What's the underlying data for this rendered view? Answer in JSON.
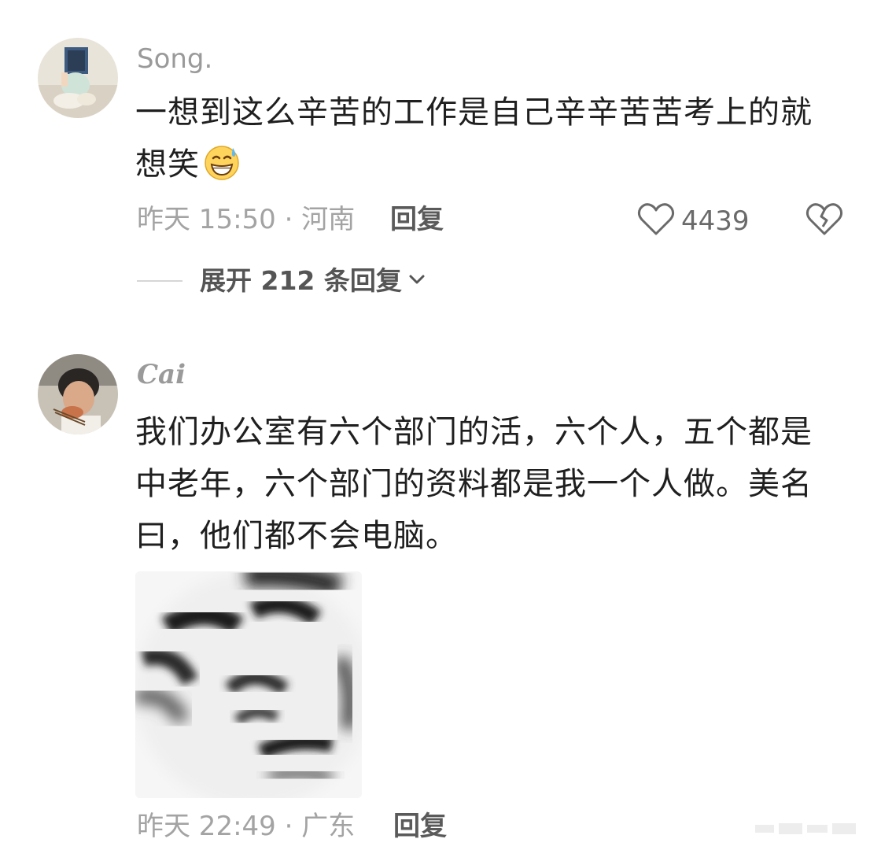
{
  "comments": [
    {
      "username": "Song.",
      "text_line1": "一想到这么辛苦的工作是自己辛辛苦苦考上的就",
      "text_line2": "想笑",
      "emoji": "grinning-sweat-emoji",
      "meta": "昨天 15:50 · 河南",
      "reply_label": "回复",
      "like_count": "4439",
      "expand_label": "展开 212 条回复"
    },
    {
      "username": "Cai",
      "text_line1": "我们办公室有六个部门的活，六个人，五个都是",
      "text_line2": "中老年，六个部门的资料都是我一个人做。美名",
      "text_line3": "曰，他们都不会电脑。",
      "sticker": "blurry-face-meme-sticker",
      "meta": "昨天 22:49 · 广东",
      "reply_label": "回复"
    }
  ],
  "icons": {
    "like": "heart-outline-icon",
    "dislike": "broken-heart-icon",
    "expand": "chevron-down-icon"
  },
  "colors": {
    "background": "#ffffff",
    "text": "#1f1f1f",
    "meta": "#a3a3a3",
    "username": "#9a9a9a"
  }
}
